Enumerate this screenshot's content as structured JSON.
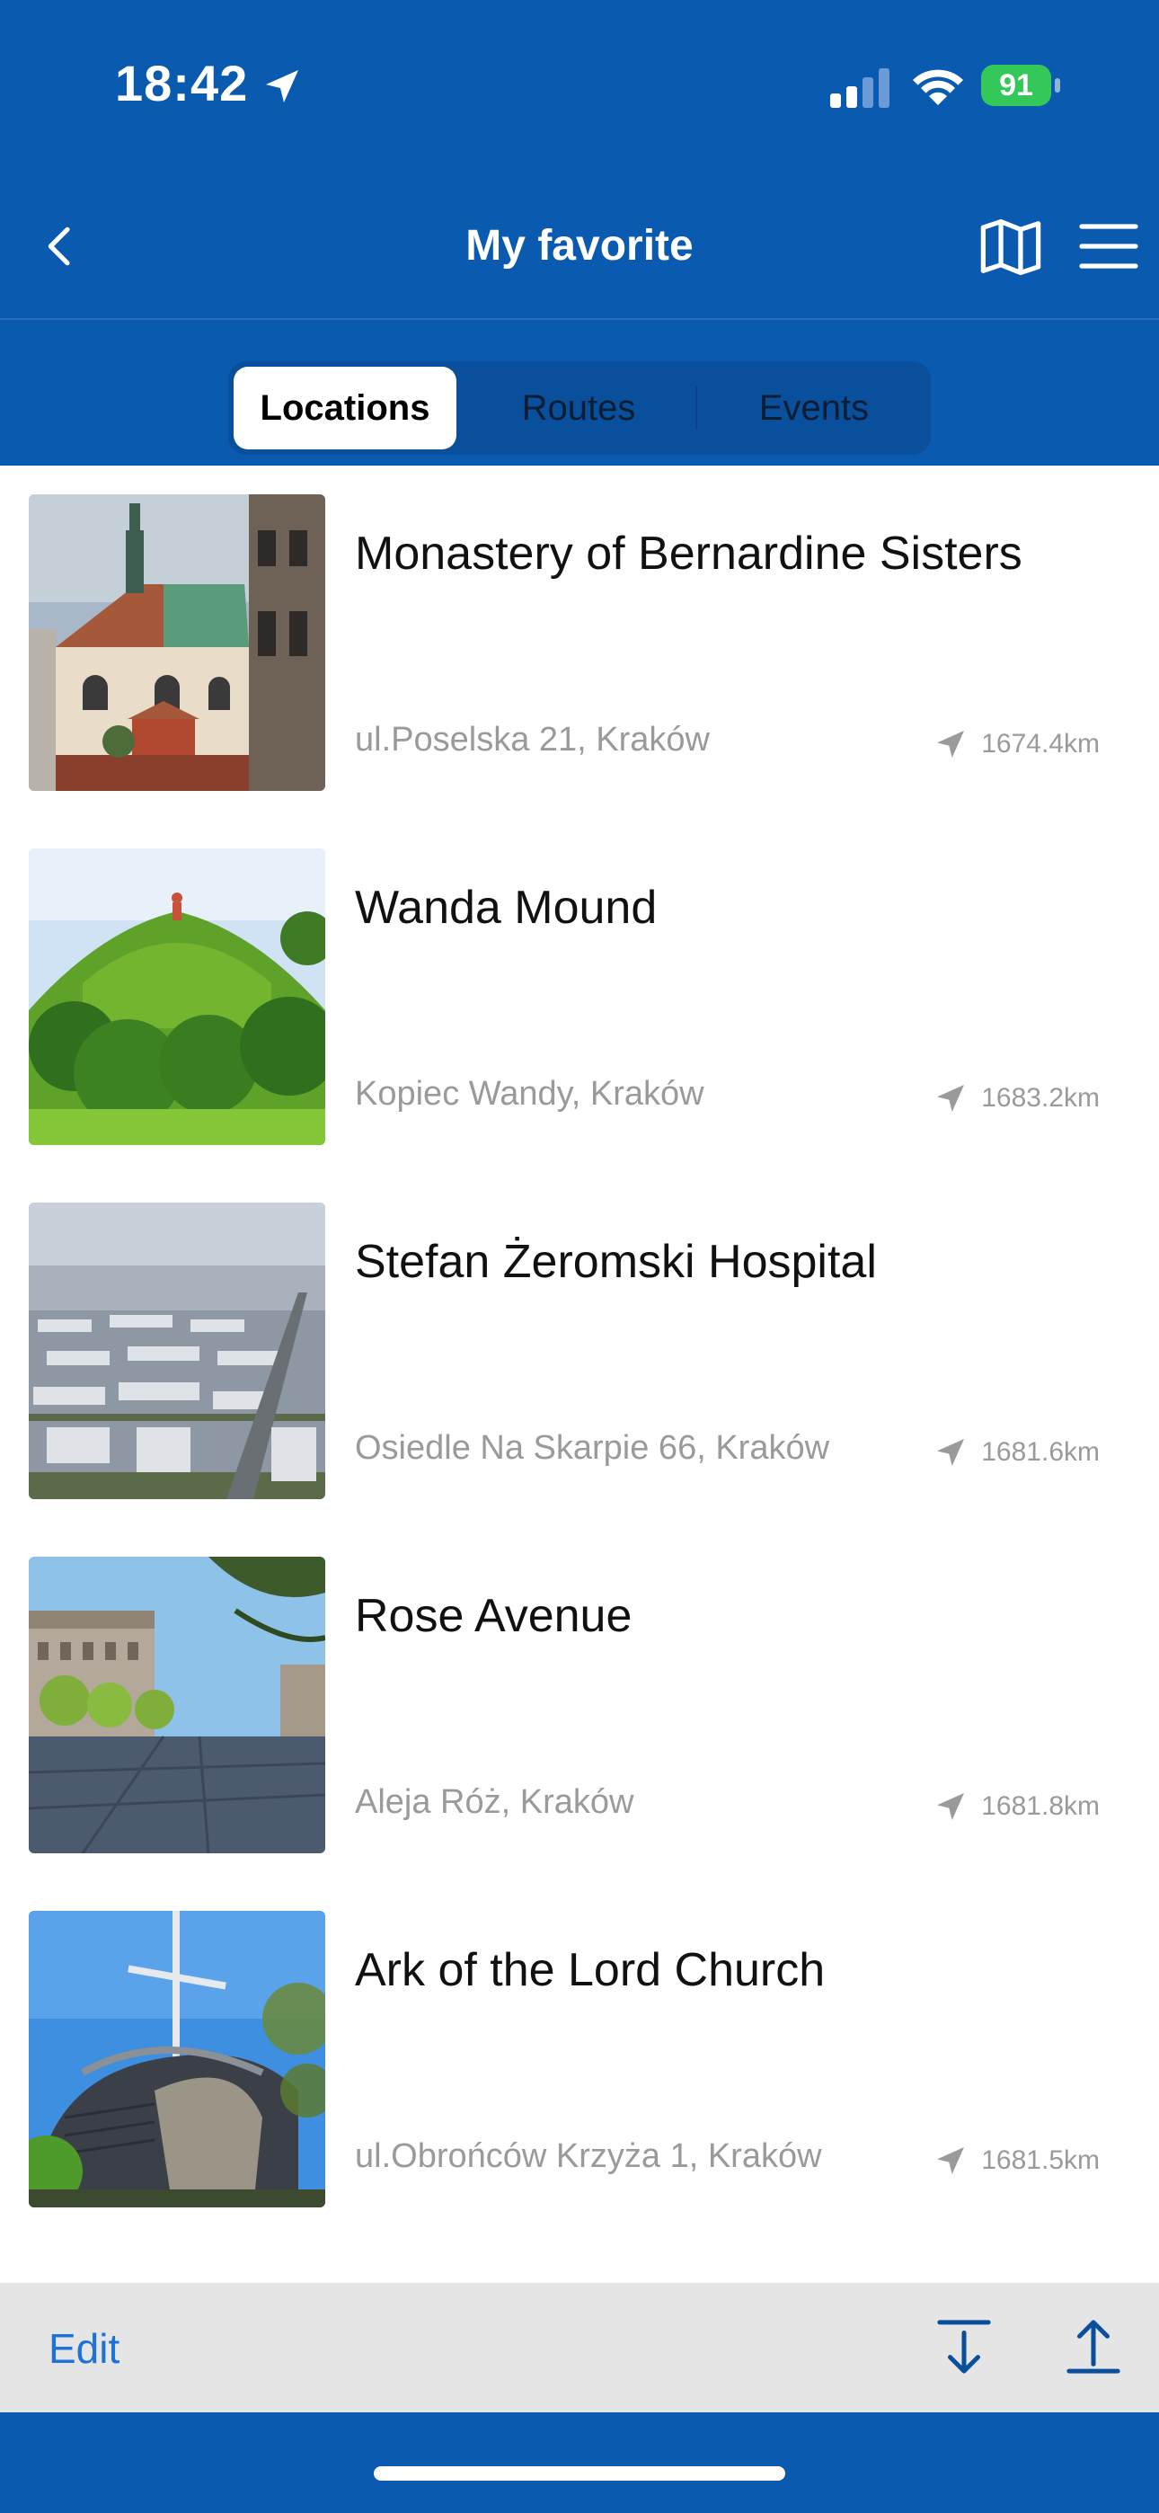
{
  "status_bar": {
    "time": "18:42",
    "battery": "91"
  },
  "nav": {
    "title": "My favorite"
  },
  "tabs": [
    {
      "label": "Locations",
      "active": true
    },
    {
      "label": "Routes",
      "active": false
    },
    {
      "label": "Events",
      "active": false
    }
  ],
  "items": [
    {
      "title": "Monastery of Bernardine Sisters",
      "address": "ul.Poselska 21, Kraków",
      "distance": "1674.4km"
    },
    {
      "title": "Wanda Mound",
      "address": "Kopiec Wandy, Kraków",
      "distance": "1683.2km"
    },
    {
      "title": "Stefan Żeromski Hospital",
      "address": "Osiedle Na Skarpie 66, Kraków",
      "distance": "1681.6km"
    },
    {
      "title": "Rose Avenue",
      "address": "Aleja Róż, Kraków",
      "distance": "1681.8km"
    },
    {
      "title": "Ark of the Lord Church",
      "address": "ul.Obrońców Krzyża 1, Kraków",
      "distance": "1681.5km"
    }
  ],
  "toolbar": {
    "edit_label": "Edit"
  },
  "colors": {
    "brand_blue": "#0a5bb0",
    "link_blue": "#1b73d9",
    "battery_green": "#34c759"
  }
}
